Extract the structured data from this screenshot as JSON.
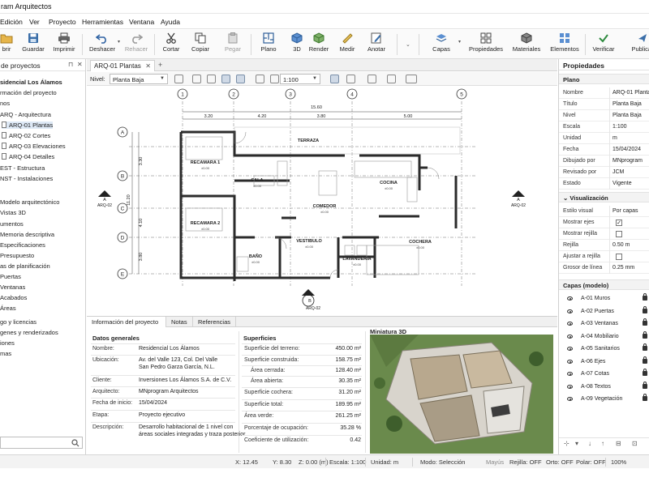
{
  "window": {
    "title": "ram Arquitectos"
  },
  "menu": [
    "Edición",
    "Ver",
    "Proyecto",
    "Herramientas",
    "Ventana",
    "Ayuda"
  ],
  "toolbar": {
    "abrir": "brir",
    "guardar": "Guardar",
    "imprimir": "Imprimir",
    "deshacer": "Deshacer",
    "rehacer": "Rehacer",
    "cortar": "Cortar",
    "copiar": "Copiar",
    "pegar": "Pegar",
    "plano": "Plano",
    "vista3d": "3D",
    "render": "Render",
    "medir": "Medir",
    "anotar": "Anotar",
    "capas": "Capas",
    "propiedades": "Propiedades",
    "materiales": "Materiales",
    "elementos": "Elementos",
    "verificar": "Verificar",
    "publicar": "Publicar"
  },
  "left_panel": {
    "title": "de proyectos",
    "items": [
      {
        "label": "sidencial Los Álamos",
        "bold": true
      },
      {
        "label": "rmación del proyecto"
      },
      {
        "label": "nos"
      },
      {
        "label": "ARQ - Arquitectura"
      },
      {
        "label": "ARQ-01 Plantas",
        "selected": true
      },
      {
        "label": "ARQ-02 Cortes"
      },
      {
        "label": "ARQ-03 Elevaciones"
      },
      {
        "label": "ARQ-04 Detalles"
      },
      {
        "label": "EST - Estructura"
      },
      {
        "label": "NST - Instalaciones"
      },
      {
        "label": "Modelo arquitectónico"
      },
      {
        "label": "Vistas 3D"
      },
      {
        "label": "umentos"
      },
      {
        "label": "Memoria descriptiva"
      },
      {
        "label": "Especificaciones"
      },
      {
        "label": "Presupuesto"
      },
      {
        "label": "as de planificación"
      },
      {
        "label": "Puertas"
      },
      {
        "label": "Ventanas"
      },
      {
        "label": "Acabados"
      },
      {
        "label": "Áreas"
      },
      {
        "label": "go y licencias"
      },
      {
        "label": "genes y renderizados"
      },
      {
        "label": "iones"
      },
      {
        "label": "mas"
      }
    ]
  },
  "doc": {
    "tab": "ARQ-01 Plantas",
    "level_label": "Nivel:",
    "level_value": "Planta Baja",
    "scale": "1:100"
  },
  "plan": {
    "grid_cols": [
      "1",
      "2",
      "3",
      "4",
      "5"
    ],
    "grid_rows": [
      "A",
      "B",
      "C",
      "D",
      "E"
    ],
    "dims_top": [
      "3.20",
      "4.20",
      "3.80",
      "5.00"
    ],
    "dim_total": "15.60",
    "dims_left": [
      "3.30",
      "11.20",
      "4.10",
      "3.80"
    ],
    "rooms": [
      {
        "name": "TERRAZA",
        "level": ""
      },
      {
        "name": "RECAMARA 1",
        "level": "±0.00"
      },
      {
        "name": "SALA",
        "level": "±0.00"
      },
      {
        "name": "COMEDOR",
        "level": "±0.00"
      },
      {
        "name": "COCINA",
        "level": "±0.00"
      },
      {
        "name": "RECAMARA 2",
        "level": "±0.00"
      },
      {
        "name": "BAÑO",
        "level": "±0.00"
      },
      {
        "name": "VESTIBULO",
        "level": "±0.00"
      },
      {
        "name": "LAVANDERÍA",
        "level": "±0.00"
      },
      {
        "name": "COCHERA",
        "level": "±0.00"
      }
    ],
    "section_marks": [
      "A",
      "ARQ-02",
      "A",
      "ARQ-02",
      "B",
      "ARQ-02"
    ]
  },
  "info": {
    "tabs": [
      "Información del proyecto",
      "Notas",
      "Referencias"
    ],
    "general_title": "Datos generales",
    "general": [
      {
        "k": "Nombre:",
        "v": "Residencial Los Álamos"
      },
      {
        "k": "Ubicación:",
        "v": "Av. del Valle 123, Col. Del Valle",
        "v2": "San Pedro Garza García, N.L."
      },
      {
        "k": "Cliente:",
        "v": "Inversiones Los Álamos S.A. de C.V."
      },
      {
        "k": "Arquitecto:",
        "v": "MNprogram Arquitectos"
      },
      {
        "k": "Fecha de inicio:",
        "v": "15/04/2024"
      },
      {
        "k": "Etapa:",
        "v": "Proyecto ejecutivo"
      },
      {
        "k": "Descripción:",
        "v": "Desarrollo habitacional de 1 nivel con",
        "v2": "áreas sociales integradas y traza posterior."
      }
    ],
    "surfaces_title": "Superficies",
    "surfaces": [
      {
        "k": "Superficie del terreno:",
        "v": "450.00 m²"
      },
      {
        "k": "Superficie construida:",
        "v": "158.75 m²"
      },
      {
        "k": "Área cerrada:",
        "v": "128.40 m²",
        "indent": true
      },
      {
        "k": "Área abierta:",
        "v": "30.35 m²",
        "indent": true
      },
      {
        "k": "Superficie cochera:",
        "v": "31.20 m²"
      },
      {
        "k": "Superficie total:",
        "v": "189.95 m²"
      },
      {
        "k": "Área verde:",
        "v": "261.25 m²"
      },
      {
        "k": "Porcentaje de ocupación:",
        "v": "35.28 %"
      },
      {
        "k": "Coeficiente de utilización:",
        "v": "0.42"
      }
    ],
    "thumb_title": "Miniatura 3D"
  },
  "properties": {
    "title": "Propiedades",
    "plano_title": "Plano",
    "plano": [
      {
        "k": "Nombre",
        "v": "ARQ-01 Plantas"
      },
      {
        "k": "Título",
        "v": "Planta Baja"
      },
      {
        "k": "Nivel",
        "v": "Planta Baja"
      },
      {
        "k": "Escala",
        "v": "1:100"
      },
      {
        "k": "Unidad",
        "v": "m"
      },
      {
        "k": "Fecha",
        "v": "15/04/2024"
      },
      {
        "k": "Dibujado por",
        "v": "MNprogram"
      },
      {
        "k": "Revisado por",
        "v": "JCM"
      },
      {
        "k": "Estado",
        "v": "Vigente"
      }
    ],
    "vis_title": "Visualización",
    "vis": [
      {
        "k": "Estilo visual",
        "v": "Por capas"
      },
      {
        "k": "Mostrar ejes",
        "check": true
      },
      {
        "k": "Mostrar rejilla",
        "check": false
      },
      {
        "k": "Rejilla",
        "v": "0.50 m"
      },
      {
        "k": "Ajustar a rejilla",
        "check": false
      },
      {
        "k": "Grosor de línea",
        "v": "0.25 mm"
      }
    ],
    "layers_title": "Capas (modelo)",
    "layers": [
      "A-01 Muros",
      "A-02 Puertas",
      "A-03 Ventanas",
      "A-04 Mobiliario",
      "A-05 Sanitarios",
      "A-06 Ejes",
      "A-07 Cotas",
      "A-08 Textos",
      "A-09 Vegetación"
    ]
  },
  "status": {
    "x": "X: 12.45",
    "y": "Y: 8.30",
    "z": "Z: 0.00 (m)",
    "escala": "Escala: 1:100",
    "unidad": "Unidad: m",
    "modo": "Modo: Selección",
    "mayus": "Mayús",
    "rejilla": "Rejilla: OFF",
    "orto": "Orto: OFF",
    "polar": "Polar: OFF",
    "zoom": "100%"
  }
}
